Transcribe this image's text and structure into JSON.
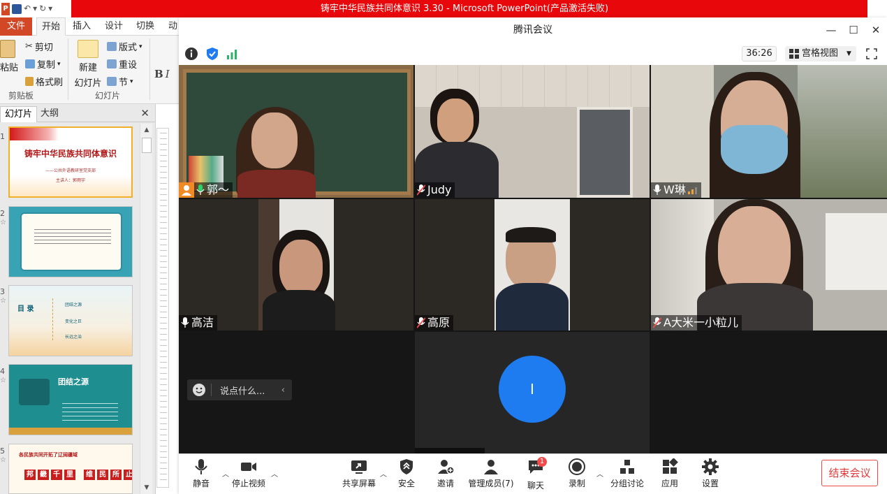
{
  "powerpoint": {
    "window_title": "铸牢中华民族共同体意识 3.30 - Microsoft PowerPoint(产品激活失败)",
    "tabs": [
      "文件",
      "开始",
      "插入",
      "设计",
      "切换",
      "动"
    ],
    "ribbon": {
      "paste": "粘贴",
      "cut": "剪切",
      "copy": "复制",
      "format_painter": "格式刷",
      "clipboard_group": "剪贴板",
      "new_slide": "新建",
      "new_slide_sub": "幻灯片",
      "layout": "版式",
      "reset": "重设",
      "section": "节",
      "slides_group": "幻灯片"
    },
    "pane_tabs": {
      "slides": "幻灯片",
      "outline": "大纲"
    },
    "slides": [
      {
        "num": "1",
        "title": "铸牢中华民族共同体意识",
        "subtitle": "——公共外语教研室党支部",
        "speaker": "主讲人：郭雨宇"
      },
      {
        "num": "2"
      },
      {
        "num": "3",
        "title": "目 录",
        "items": [
          "团结之源",
          "变化之巨",
          "长远之治"
        ]
      },
      {
        "num": "4",
        "title": "团结之源"
      },
      {
        "num": "5",
        "header": "各民族共同开拓了辽阔疆域",
        "boxes": [
          "邦",
          "畿",
          "千",
          "里",
          "维",
          "民",
          "所",
          "止"
        ]
      }
    ]
  },
  "meeting": {
    "app_title": "腾讯会议",
    "timer": "36:26",
    "view_mode": "宫格视图",
    "participants": [
      {
        "name": "郭～",
        "mic": "on",
        "host": true
      },
      {
        "name": "Judy",
        "mic": "muted"
      },
      {
        "name": "W琳",
        "mic": "on",
        "speaking": true
      },
      {
        "name": "高洁",
        "mic": "on"
      },
      {
        "name": "高原",
        "mic": "muted"
      },
      {
        "name": "A大米一小粒儿",
        "mic": "muted"
      },
      {
        "name": "",
        "avatar_letter": "I"
      }
    ],
    "chat_placeholder": "说点什么...",
    "toolbar": {
      "mute": "静音",
      "stop_video": "停止视频",
      "share_screen": "共享屏幕",
      "security": "安全",
      "invite": "邀请",
      "manage_members": "管理成员(7)",
      "chat": "聊天",
      "chat_badge": "1",
      "record": "录制",
      "breakout": "分组讨论",
      "apps": "应用",
      "settings": "设置",
      "end_meeting": "结束会议"
    },
    "colors": {
      "accent": "#1e7bf0",
      "end": "#e23b3b",
      "tile_bg": "#161616"
    }
  }
}
